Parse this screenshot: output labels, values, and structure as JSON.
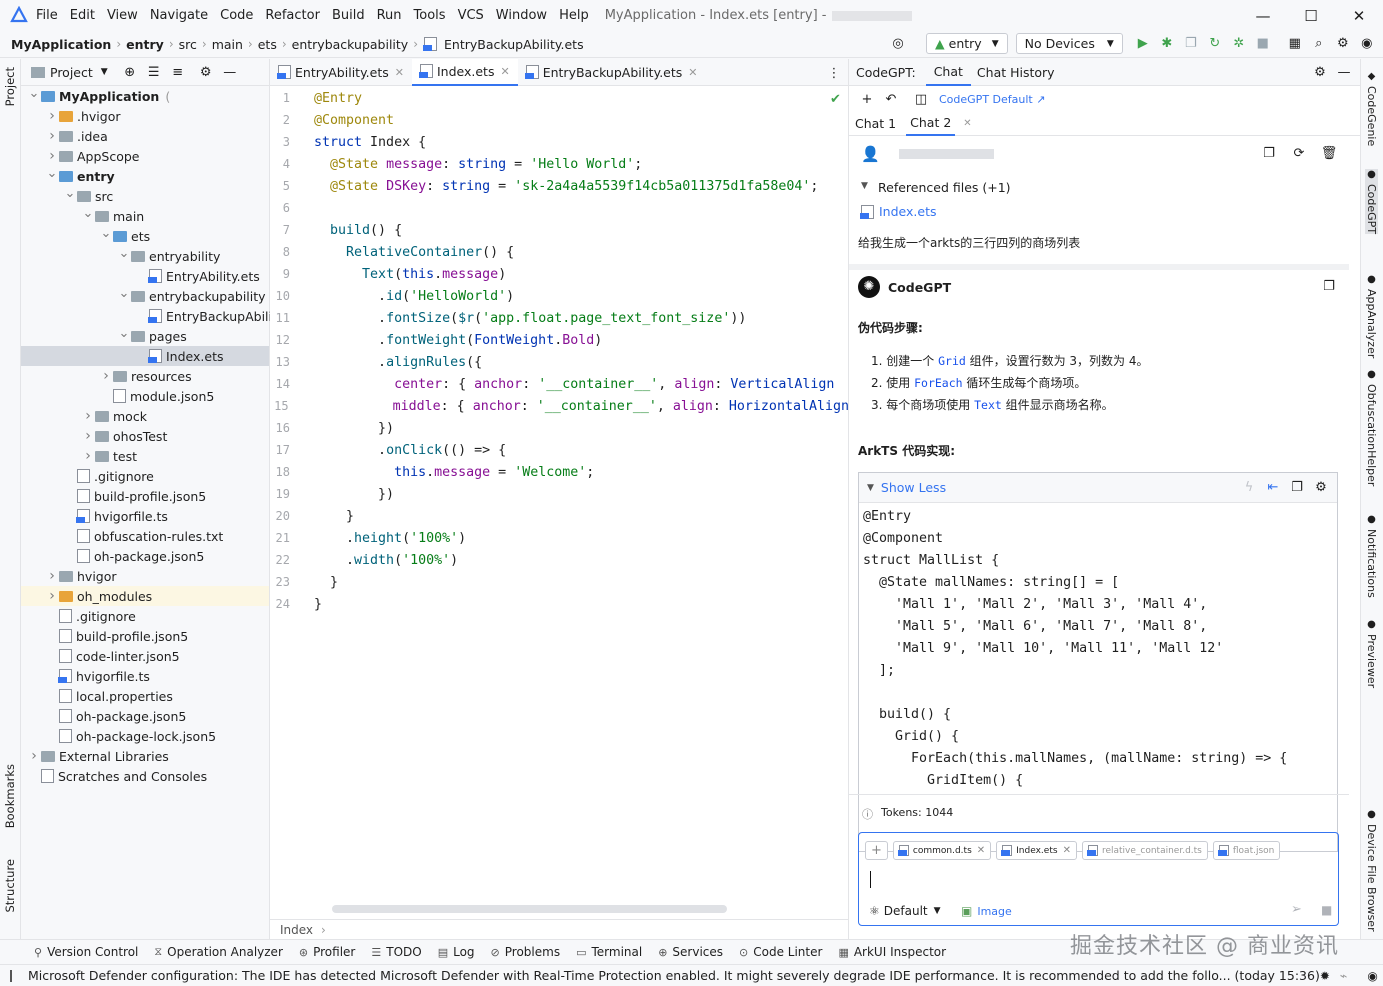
{
  "window": {
    "menu": [
      "File",
      "Edit",
      "View",
      "Navigate",
      "Code",
      "Refactor",
      "Build",
      "Run",
      "Tools",
      "VCS",
      "Window",
      "Help"
    ],
    "title": "MyApplication - Index.ets [entry] -",
    "controls": {
      "minimize": "—",
      "maximize": "☐",
      "close": "✕"
    }
  },
  "nav": {
    "breadcrumb": [
      "MyApplication",
      "entry",
      "src",
      "main",
      "ets",
      "entrybackupability",
      "EntryBackupAbility.ets"
    ],
    "run_config": "entry",
    "devices": "No Devices"
  },
  "left_stripe": {
    "project": "Project",
    "bookmarks": "Bookmarks",
    "structure": "Structure"
  },
  "project": {
    "header": "Project",
    "tree": [
      {
        "label": "MyApplication",
        "extra": "(",
        "depth": 0,
        "arrow": "v",
        "kind": "folder-blue",
        "bold": true
      },
      {
        "label": ".hvigor",
        "depth": 1,
        "arrow": ">",
        "kind": "folder-orange"
      },
      {
        "label": ".idea",
        "depth": 1,
        "arrow": ">",
        "kind": "folder"
      },
      {
        "label": "AppScope",
        "depth": 1,
        "arrow": ">",
        "kind": "folder"
      },
      {
        "label": "entry",
        "depth": 1,
        "arrow": "v",
        "kind": "folder-blue",
        "bold": true
      },
      {
        "label": "src",
        "depth": 2,
        "arrow": "v",
        "kind": "folder"
      },
      {
        "label": "main",
        "depth": 3,
        "arrow": "v",
        "kind": "folder"
      },
      {
        "label": "ets",
        "depth": 4,
        "arrow": "v",
        "kind": "folder-blue"
      },
      {
        "label": "entryability",
        "depth": 5,
        "arrow": "v",
        "kind": "folder"
      },
      {
        "label": "EntryAbility.ets",
        "depth": 6,
        "arrow": "",
        "kind": "file-ts"
      },
      {
        "label": "entrybackupability",
        "depth": 5,
        "arrow": "v",
        "kind": "folder"
      },
      {
        "label": "EntryBackupAbili",
        "depth": 6,
        "arrow": "",
        "kind": "file-ts"
      },
      {
        "label": "pages",
        "depth": 5,
        "arrow": "v",
        "kind": "folder"
      },
      {
        "label": "Index.ets",
        "depth": 6,
        "arrow": "",
        "kind": "file-ts",
        "selected": true
      },
      {
        "label": "resources",
        "depth": 4,
        "arrow": ">",
        "kind": "folder"
      },
      {
        "label": "module.json5",
        "depth": 4,
        "arrow": "",
        "kind": "file"
      },
      {
        "label": "mock",
        "depth": 3,
        "arrow": ">",
        "kind": "folder"
      },
      {
        "label": "ohosTest",
        "depth": 3,
        "arrow": ">",
        "kind": "folder"
      },
      {
        "label": "test",
        "depth": 3,
        "arrow": ">",
        "kind": "folder"
      },
      {
        "label": ".gitignore",
        "depth": 2,
        "arrow": "",
        "kind": "file"
      },
      {
        "label": "build-profile.json5",
        "depth": 2,
        "arrow": "",
        "kind": "file"
      },
      {
        "label": "hvigorfile.ts",
        "depth": 2,
        "arrow": "",
        "kind": "file-ts"
      },
      {
        "label": "obfuscation-rules.txt",
        "depth": 2,
        "arrow": "",
        "kind": "file"
      },
      {
        "label": "oh-package.json5",
        "depth": 2,
        "arrow": "",
        "kind": "file"
      },
      {
        "label": "hvigor",
        "depth": 1,
        "arrow": ">",
        "kind": "folder"
      },
      {
        "label": "oh_modules",
        "depth": 1,
        "arrow": ">",
        "kind": "folder-orange",
        "highlight": true
      },
      {
        "label": ".gitignore",
        "depth": 1,
        "arrow": "",
        "kind": "file"
      },
      {
        "label": "build-profile.json5",
        "depth": 1,
        "arrow": "",
        "kind": "file"
      },
      {
        "label": "code-linter.json5",
        "depth": 1,
        "arrow": "",
        "kind": "file"
      },
      {
        "label": "hvigorfile.ts",
        "depth": 1,
        "arrow": "",
        "kind": "file-ts"
      },
      {
        "label": "local.properties",
        "depth": 1,
        "arrow": "",
        "kind": "file"
      },
      {
        "label": "oh-package.json5",
        "depth": 1,
        "arrow": "",
        "kind": "file"
      },
      {
        "label": "oh-package-lock.json5",
        "depth": 1,
        "arrow": "",
        "kind": "file"
      },
      {
        "label": "External Libraries",
        "depth": 0,
        "arrow": ">",
        "kind": "lib"
      },
      {
        "label": "Scratches and Consoles",
        "depth": 0,
        "arrow": "",
        "kind": "scratch"
      }
    ]
  },
  "editor": {
    "tabs": [
      {
        "label": "EntryAbility.ets",
        "active": false
      },
      {
        "label": "Index.ets",
        "active": true
      },
      {
        "label": "EntryBackupAbility.ets",
        "active": false
      }
    ],
    "breadcrumb": "Index",
    "lines": [
      [
        [
          "@Entry",
          "d"
        ]
      ],
      [
        [
          "@Component",
          "d"
        ]
      ],
      [
        [
          "struct ",
          "k"
        ],
        [
          "Index {",
          "t"
        ]
      ],
      [
        [
          "  @State ",
          "d"
        ],
        [
          "message",
          "p"
        ],
        [
          ": ",
          "t"
        ],
        [
          "string",
          "tp"
        ],
        [
          " = ",
          "t"
        ],
        [
          "'Hello World'",
          "s"
        ],
        [
          ";",
          "t"
        ]
      ],
      [
        [
          "  @State ",
          "d"
        ],
        [
          "DSKey",
          "p"
        ],
        [
          ": ",
          "t"
        ],
        [
          "string",
          "tp"
        ],
        [
          " = ",
          "t"
        ],
        [
          "'sk-2a4a4a5539f14cb5a011375d1fa58e04'",
          "s"
        ],
        [
          ";",
          "t"
        ]
      ],
      [
        [
          "",
          "t"
        ]
      ],
      [
        [
          "  ",
          "t"
        ],
        [
          "build",
          "f"
        ],
        [
          "() {",
          "t"
        ]
      ],
      [
        [
          "    ",
          "t"
        ],
        [
          "RelativeContainer",
          "f"
        ],
        [
          "() {",
          "t"
        ]
      ],
      [
        [
          "      ",
          "t"
        ],
        [
          "Text",
          "f"
        ],
        [
          "(",
          "t"
        ],
        [
          "this",
          "k"
        ],
        [
          ".",
          "t"
        ],
        [
          "message",
          "p"
        ],
        [
          ")",
          "t"
        ]
      ],
      [
        [
          "        .",
          "t"
        ],
        [
          "id",
          "f"
        ],
        [
          "(",
          "t"
        ],
        [
          "'HelloWorld'",
          "s"
        ],
        [
          ")",
          "t"
        ]
      ],
      [
        [
          "        .",
          "t"
        ],
        [
          "fontSize",
          "f"
        ],
        [
          "(",
          "t"
        ],
        [
          "$r",
          "f"
        ],
        [
          "(",
          "t"
        ],
        [
          "'app.float.page_text_font_size'",
          "s"
        ],
        [
          "))",
          "t"
        ]
      ],
      [
        [
          "        .",
          "t"
        ],
        [
          "fontWeight",
          "f"
        ],
        [
          "(",
          "t"
        ],
        [
          "FontWeight",
          "tp"
        ],
        [
          ".",
          "t"
        ],
        [
          "Bold",
          "p"
        ],
        [
          ")",
          "t"
        ]
      ],
      [
        [
          "        .",
          "t"
        ],
        [
          "alignRules",
          "f"
        ],
        [
          "({",
          "t"
        ]
      ],
      [
        [
          "          ",
          "t"
        ],
        [
          "center",
          "p"
        ],
        [
          ": { ",
          "t"
        ],
        [
          "anchor",
          "p"
        ],
        [
          ": ",
          "t"
        ],
        [
          "'__container__'",
          "s"
        ],
        [
          ", ",
          "t"
        ],
        [
          "align",
          "p"
        ],
        [
          ": ",
          "t"
        ],
        [
          "VerticalAlign",
          "tp"
        ]
      ],
      [
        [
          "          ",
          "t"
        ],
        [
          "middle",
          "p"
        ],
        [
          ": { ",
          "t"
        ],
        [
          "anchor",
          "p"
        ],
        [
          ": ",
          "t"
        ],
        [
          "'__container__'",
          "s"
        ],
        [
          ", ",
          "t"
        ],
        [
          "align",
          "p"
        ],
        [
          ": ",
          "t"
        ],
        [
          "HorizontalAlign",
          "tp"
        ]
      ],
      [
        [
          "        })",
          "t"
        ]
      ],
      [
        [
          "        .",
          "t"
        ],
        [
          "onClick",
          "f"
        ],
        [
          "(() => {",
          "t"
        ]
      ],
      [
        [
          "          ",
          "t"
        ],
        [
          "this",
          "k"
        ],
        [
          ".",
          "t"
        ],
        [
          "message",
          "p"
        ],
        [
          " = ",
          "t"
        ],
        [
          "'Welcome'",
          "s"
        ],
        [
          ";",
          "t"
        ]
      ],
      [
        [
          "        })",
          "t"
        ]
      ],
      [
        [
          "    }",
          "t"
        ]
      ],
      [
        [
          "    .",
          "t"
        ],
        [
          "height",
          "f"
        ],
        [
          "(",
          "t"
        ],
        [
          "'100%'",
          "s"
        ],
        [
          ")",
          "t"
        ]
      ],
      [
        [
          "    .",
          "t"
        ],
        [
          "width",
          "f"
        ],
        [
          "(",
          "t"
        ],
        [
          "'100%'",
          "s"
        ],
        [
          ")",
          "t"
        ]
      ],
      [
        [
          "  }",
          "t"
        ]
      ],
      [
        [
          "}",
          "t"
        ]
      ]
    ]
  },
  "codegpt": {
    "header": "CodeGPT:",
    "tabs": [
      "Chat",
      "Chat History"
    ],
    "model": "CodeGPT Default ↗",
    "chat_tabs": [
      "Chat 1",
      "Chat 2"
    ],
    "user_name": "",
    "referenced": "Referenced files (+1)",
    "ref_file": "Index.ets",
    "prompt": "给我生成一个arkts的三行四列的商场列表",
    "bot_name": "CodeGPT",
    "pseudo_title": "伪代码步骤:",
    "steps": [
      [
        [
          "创建一个 ",
          "t"
        ],
        [
          "Grid",
          "c"
        ],
        [
          " 组件，设置行数为 3，列数为 4。",
          "t"
        ]
      ],
      [
        [
          "使用 ",
          "t"
        ],
        [
          "ForEach",
          "c"
        ],
        [
          " 循环生成每个商场项。",
          "t"
        ]
      ],
      [
        [
          "每个商场项使用 ",
          "t"
        ],
        [
          "Text",
          "c"
        ],
        [
          " 组件显示商场名称。",
          "t"
        ]
      ]
    ],
    "impl_title": "ArkTS 代码实现:",
    "show_less": "Show Less",
    "code": [
      "@Entry",
      "@Component",
      "struct MallList {",
      "  @State mallNames: string[] = [",
      "    'Mall 1', 'Mall 2', 'Mall 3', 'Mall 4',",
      "    'Mall 5', 'Mall 6', 'Mall 7', 'Mall 8',",
      "    'Mall 9', 'Mall 10', 'Mall 11', 'Mall 12'",
      "  ];",
      "",
      "  build() {",
      "    Grid() {",
      "      ForEach(this.mallNames, (mallName: string) => {",
      "        GridItem() {"
    ],
    "tokens": "Tokens: 1044",
    "chips": [
      "common.d.ts",
      "Index.ets",
      "relative_container.d.ts",
      "float.json"
    ],
    "mode": "Default",
    "image": "Image"
  },
  "right_stripe": [
    "CodeGenie",
    "CodeGPT",
    "AppAnalyzer",
    "ObfuscationHelper",
    "Notifications",
    "Previewer",
    "Device File Browser"
  ],
  "bottom": [
    "Version Control",
    "Operation Analyzer",
    "Profiler",
    "TODO",
    "Log",
    "Problems",
    "Terminal",
    "Services",
    "Code Linter",
    "ArkUI Inspector"
  ],
  "status": "Microsoft Defender configuration: The IDE has detected Microsoft Defender with Real-Time Protection enabled. It might severely degrade IDE performance. It is recommended to add the follo... (today 15:36)",
  "watermark": "掘金技术社区 @ 商业资讯",
  "colors": {
    "accent": "#3574f0",
    "run": "#3fa34d",
    "keyword": "#0033b3",
    "decorator": "#9e880d",
    "string": "#067d17",
    "function": "#00627a",
    "property": "#871094"
  }
}
